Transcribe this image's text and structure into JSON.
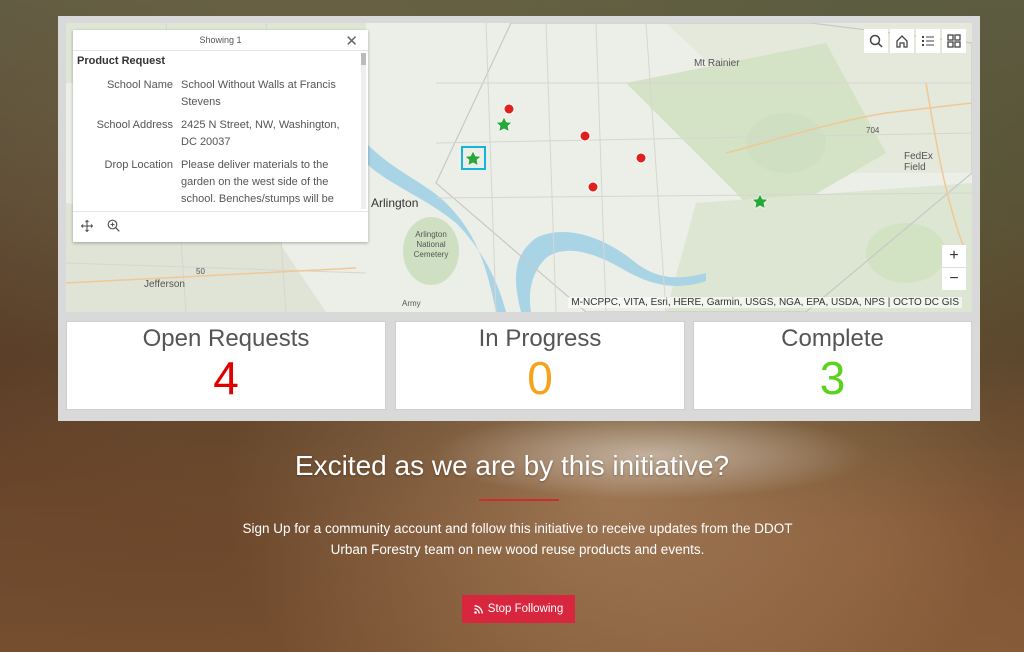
{
  "map": {
    "labels": {
      "mt_rainier": "Mt Rainier",
      "fedex_field": "FedEx Field",
      "arlington": "Arlington",
      "arlington_cemetery": "Arlington National Cemetery",
      "jefferson": "Jefferson",
      "army": "Army",
      "route_704": "704",
      "route_50": "50"
    },
    "attribution": "M-NCPPC, VITA, Esri, HERE, Garmin, USGS, NGA, EPA, USDA, NPS | OCTO DC GIS",
    "zoom_in": "+",
    "zoom_out": "−",
    "tools": [
      "search-icon",
      "home-icon",
      "legend-icon",
      "basemap-icon"
    ]
  },
  "popup": {
    "header": "Showing 1",
    "title": "Product Request",
    "fields": [
      {
        "key": "School Name",
        "value": "School Without Walls at Francis Stevens"
      },
      {
        "key": "School Address",
        "value": "2425 N Street, NW, Washington, DC 20037"
      },
      {
        "key": "Drop Location",
        "value": "Please deliver materials to the garden on the west side of the school. Benches/stumps will be"
      }
    ]
  },
  "stats": {
    "open": {
      "label": "Open Requests",
      "value": "4",
      "color": "#e00000"
    },
    "progress": {
      "label": "In Progress",
      "value": "0",
      "color": "#f7a21b"
    },
    "complete": {
      "label": "Complete",
      "value": "3",
      "color": "#5ad31a"
    }
  },
  "cta": {
    "title": "Excited as we are by this initiative?",
    "text": "Sign Up for a community account and follow this initiative to receive updates from the DDOT Urban Forestry team on new wood reuse products and events.",
    "button": "Stop Following"
  }
}
